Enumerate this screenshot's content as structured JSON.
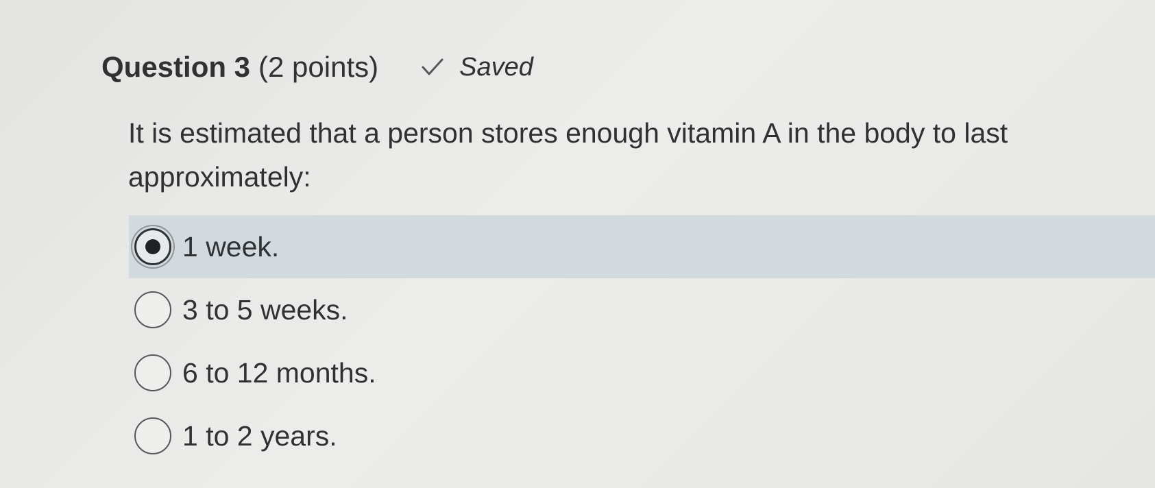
{
  "question": {
    "title": "Question 3",
    "points": "(2 points)",
    "status_icon": "check-icon",
    "status_text": "Saved",
    "text": "It is estimated that a person stores enough vitamin A in the body to last approximately:"
  },
  "options": [
    {
      "label": "1 week.",
      "selected": true
    },
    {
      "label": "3 to 5 weeks.",
      "selected": false
    },
    {
      "label": "6 to 12 months.",
      "selected": false
    },
    {
      "label": "1 to 2 years.",
      "selected": false
    }
  ],
  "colors": {
    "selected_row_background": "#d2dadf",
    "text": "#2f3133",
    "page_background": "#e8e8e6"
  }
}
